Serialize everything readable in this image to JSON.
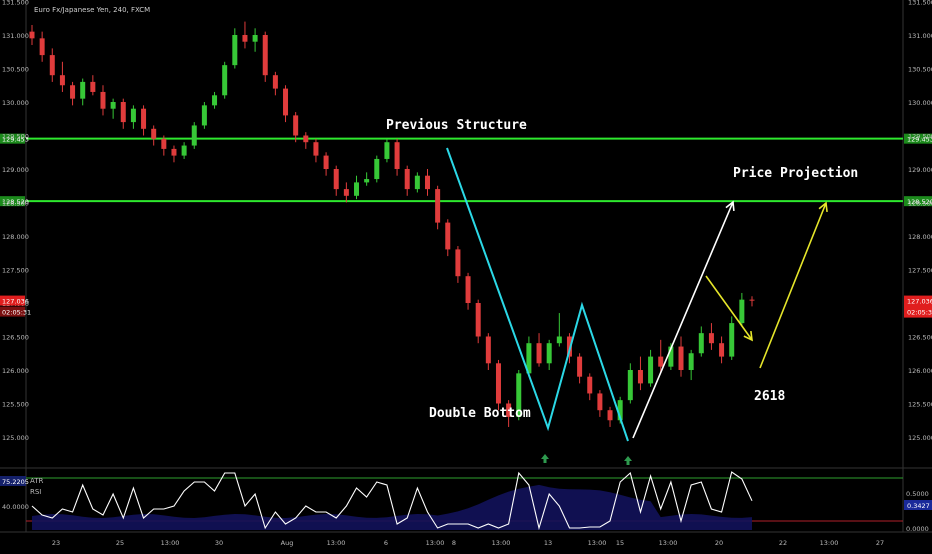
{
  "header": {
    "symbol_title": "Euro Fx/Japanese Yen, 240, FXCM"
  },
  "colors": {
    "background": "#000000",
    "bull": "#37c837",
    "bear": "#e03c3c",
    "level_line": "#2ee82e",
    "pattern_line": "#2bd8e6",
    "projection_white": "#ffffff",
    "projection_yellow": "#e6e62a",
    "atr_fill": "#12125a",
    "rsi_line": "#ffffff",
    "price_marker": "#e01e1e",
    "level_marker": "#1c8a1c",
    "rsi_upper": "#2ea02e",
    "rsi_lower": "#b0202a",
    "marker_arrow": "#2e9a4e",
    "atr_marker": "#1a2a9a"
  },
  "annotations": {
    "previous_structure": "Previous Structure",
    "price_projection": "Price Projection",
    "double_bottom": "Double Bottom",
    "fib_2618": "2618"
  },
  "price_axis": {
    "ticks": [
      "131.500",
      "131.000",
      "130.500",
      "130.000",
      "129.500",
      "129.000",
      "128.500",
      "128.000",
      "127.500",
      "127.000",
      "126.500",
      "126.000",
      "125.500",
      "125.000"
    ],
    "last_price": "127.036",
    "countdown": "02:05:31",
    "level_upper": "129.453",
    "level_lower": "128.520"
  },
  "time_axis": {
    "labels": [
      "23",
      "25",
      "13:00",
      "30",
      "Aug",
      "13:00",
      "6",
      "13:00",
      "8",
      "13:00",
      "13",
      "13:00",
      "15",
      "13:00",
      "20",
      "22",
      "13:00",
      "27"
    ]
  },
  "indicator_pane": {
    "atr_label": "ATR",
    "rsi_label": "RSI",
    "atr_value": "75.2205",
    "rsi_level": "40.0000",
    "right_ticks": [
      "0.5000",
      "0.0000"
    ],
    "atr_right_value": "0.3427"
  },
  "chart_data": {
    "type": "candlestick",
    "title": "Euro Fx/Japanese Yen, 240, FXCM",
    "ylim": [
      124.6,
      131.6
    ],
    "levels": [
      129.453,
      128.52
    ],
    "last_price": 127.036,
    "candles": [
      [
        131.05,
        131.15,
        130.85,
        130.95
      ],
      [
        130.95,
        131.05,
        130.6,
        130.7
      ],
      [
        130.7,
        130.8,
        130.3,
        130.4
      ],
      [
        130.4,
        130.6,
        130.15,
        130.25
      ],
      [
        130.25,
        130.3,
        129.95,
        130.05
      ],
      [
        130.05,
        130.35,
        129.95,
        130.3
      ],
      [
        130.3,
        130.4,
        130.1,
        130.15
      ],
      [
        130.15,
        130.25,
        129.8,
        129.9
      ],
      [
        129.9,
        130.05,
        129.75,
        130.0
      ],
      [
        130.0,
        130.05,
        129.6,
        129.7
      ],
      [
        129.7,
        129.95,
        129.6,
        129.9
      ],
      [
        129.9,
        129.95,
        129.5,
        129.6
      ],
      [
        129.6,
        129.65,
        129.35,
        129.45
      ],
      [
        129.45,
        129.5,
        129.2,
        129.3
      ],
      [
        129.3,
        129.35,
        129.1,
        129.2
      ],
      [
        129.2,
        129.4,
        129.15,
        129.35
      ],
      [
        129.35,
        129.7,
        129.3,
        129.65
      ],
      [
        129.65,
        130.0,
        129.6,
        129.95
      ],
      [
        129.95,
        130.15,
        129.9,
        130.1
      ],
      [
        130.1,
        130.6,
        130.05,
        130.55
      ],
      [
        130.55,
        131.1,
        130.5,
        131.0
      ],
      [
        131.0,
        131.2,
        130.8,
        130.9
      ],
      [
        130.9,
        131.1,
        130.75,
        131.0
      ],
      [
        131.0,
        131.05,
        130.3,
        130.4
      ],
      [
        130.4,
        130.45,
        130.1,
        130.2
      ],
      [
        130.2,
        130.25,
        129.7,
        129.8
      ],
      [
        129.8,
        129.85,
        129.4,
        129.5
      ],
      [
        129.5,
        129.55,
        129.3,
        129.4
      ],
      [
        129.4,
        129.45,
        129.1,
        129.2
      ],
      [
        129.2,
        129.25,
        128.9,
        129.0
      ],
      [
        129.0,
        129.05,
        128.6,
        128.7
      ],
      [
        128.7,
        128.8,
        128.5,
        128.6
      ],
      [
        128.6,
        128.9,
        128.55,
        128.8
      ],
      [
        128.8,
        128.95,
        128.75,
        128.85
      ],
      [
        128.85,
        129.2,
        128.8,
        129.15
      ],
      [
        129.15,
        129.45,
        129.1,
        129.4
      ],
      [
        129.4,
        129.45,
        128.9,
        129.0
      ],
      [
        129.0,
        129.05,
        128.6,
        128.7
      ],
      [
        128.7,
        128.95,
        128.65,
        128.9
      ],
      [
        128.9,
        129.0,
        128.6,
        128.7
      ],
      [
        128.7,
        128.75,
        128.1,
        128.2
      ],
      [
        128.2,
        128.25,
        127.7,
        127.8
      ],
      [
        127.8,
        127.85,
        127.3,
        127.4
      ],
      [
        127.4,
        127.45,
        126.9,
        127.0
      ],
      [
        127.0,
        127.05,
        126.4,
        126.5
      ],
      [
        126.5,
        126.55,
        126.0,
        126.1
      ],
      [
        126.1,
        126.15,
        125.4,
        125.5
      ],
      [
        125.5,
        125.55,
        125.15,
        125.3
      ],
      [
        125.3,
        126.0,
        125.25,
        125.95
      ],
      [
        125.95,
        126.5,
        125.9,
        126.4
      ],
      [
        126.4,
        126.55,
        126.05,
        126.1
      ],
      [
        126.1,
        126.45,
        126.0,
        126.4
      ],
      [
        126.4,
        126.85,
        126.35,
        126.5
      ],
      [
        126.5,
        126.55,
        126.1,
        126.2
      ],
      [
        126.2,
        126.25,
        125.8,
        125.9
      ],
      [
        125.9,
        125.95,
        125.55,
        125.65
      ],
      [
        125.65,
        125.7,
        125.3,
        125.4
      ],
      [
        125.4,
        125.45,
        125.15,
        125.25
      ],
      [
        125.25,
        125.6,
        125.2,
        125.55
      ],
      [
        125.55,
        126.1,
        125.5,
        126.0
      ],
      [
        126.0,
        126.2,
        125.7,
        125.8
      ],
      [
        125.8,
        126.3,
        125.75,
        126.2
      ],
      [
        126.2,
        126.45,
        125.95,
        126.05
      ],
      [
        126.05,
        126.4,
        126.0,
        126.35
      ],
      [
        126.35,
        126.5,
        125.9,
        126.0
      ],
      [
        126.0,
        126.3,
        125.85,
        126.25
      ],
      [
        126.25,
        126.65,
        126.2,
        126.55
      ],
      [
        126.55,
        126.7,
        126.3,
        126.4
      ],
      [
        126.4,
        126.5,
        126.1,
        126.2
      ],
      [
        126.2,
        126.8,
        126.15,
        126.7
      ],
      [
        126.7,
        127.15,
        126.65,
        127.05
      ],
      [
        127.05,
        127.1,
        126.95,
        127.036
      ]
    ]
  }
}
